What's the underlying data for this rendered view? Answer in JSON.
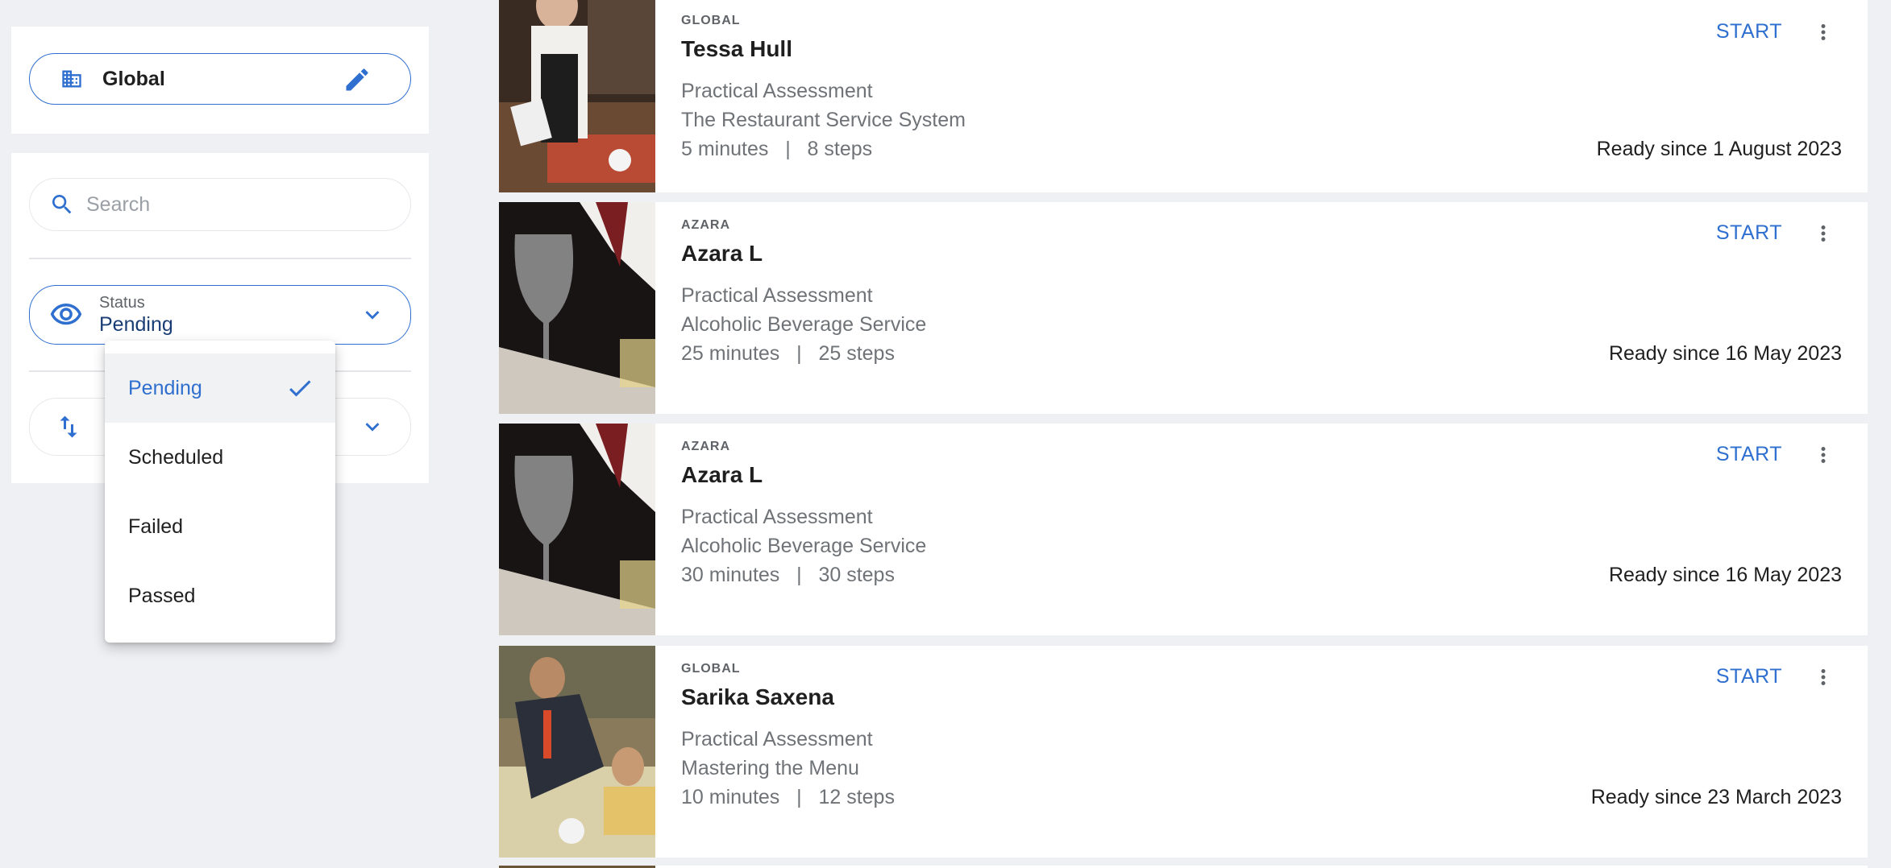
{
  "location": {
    "label": "Global"
  },
  "search": {
    "placeholder": "Search",
    "value": ""
  },
  "status_filter": {
    "caption": "Status",
    "value": "Pending"
  },
  "status_menu": {
    "options": [
      "Pending",
      "Scheduled",
      "Failed",
      "Passed"
    ],
    "selected": "Pending"
  },
  "colors": {
    "accent": "#2f6fcf",
    "status_value": "#1a3d75",
    "background": "#eef0f3"
  },
  "icons": {
    "location": "building-icon",
    "edit": "pencil-icon",
    "search": "search-icon",
    "status": "eye-icon",
    "sort": "sort-arrows-icon",
    "dropdown": "chevron-down-icon",
    "selected": "check-icon",
    "card_menu": "more-vert-icon"
  },
  "assessments": [
    {
      "org": "GLOBAL",
      "name": "Tessa Hull",
      "type": "Practical Assessment",
      "course": "The Restaurant Service System",
      "duration": "5 minutes",
      "steps": "8 steps",
      "meta": "5 minutes   |   8 steps",
      "action": "START",
      "ready": "Ready since 1 August 2023"
    },
    {
      "org": "AZARA",
      "name": "Azara L",
      "type": "Practical Assessment",
      "course": "Alcoholic Beverage Service",
      "duration": "25 minutes",
      "steps": "25 steps",
      "meta": "25 minutes   |   25 steps",
      "action": "START",
      "ready": "Ready since 16 May 2023"
    },
    {
      "org": "AZARA",
      "name": "Azara L",
      "type": "Practical Assessment",
      "course": "Alcoholic Beverage Service",
      "duration": "30 minutes",
      "steps": "30 steps",
      "meta": "30 minutes   |   30 steps",
      "action": "START",
      "ready": "Ready since 16 May 2023"
    },
    {
      "org": "GLOBAL",
      "name": "Sarika Saxena",
      "type": "Practical Assessment",
      "course": "Mastering the Menu",
      "duration": "10 minutes",
      "steps": "12 steps",
      "meta": "10 minutes   |   12 steps",
      "action": "START",
      "ready": "Ready since 23 March 2023"
    }
  ]
}
